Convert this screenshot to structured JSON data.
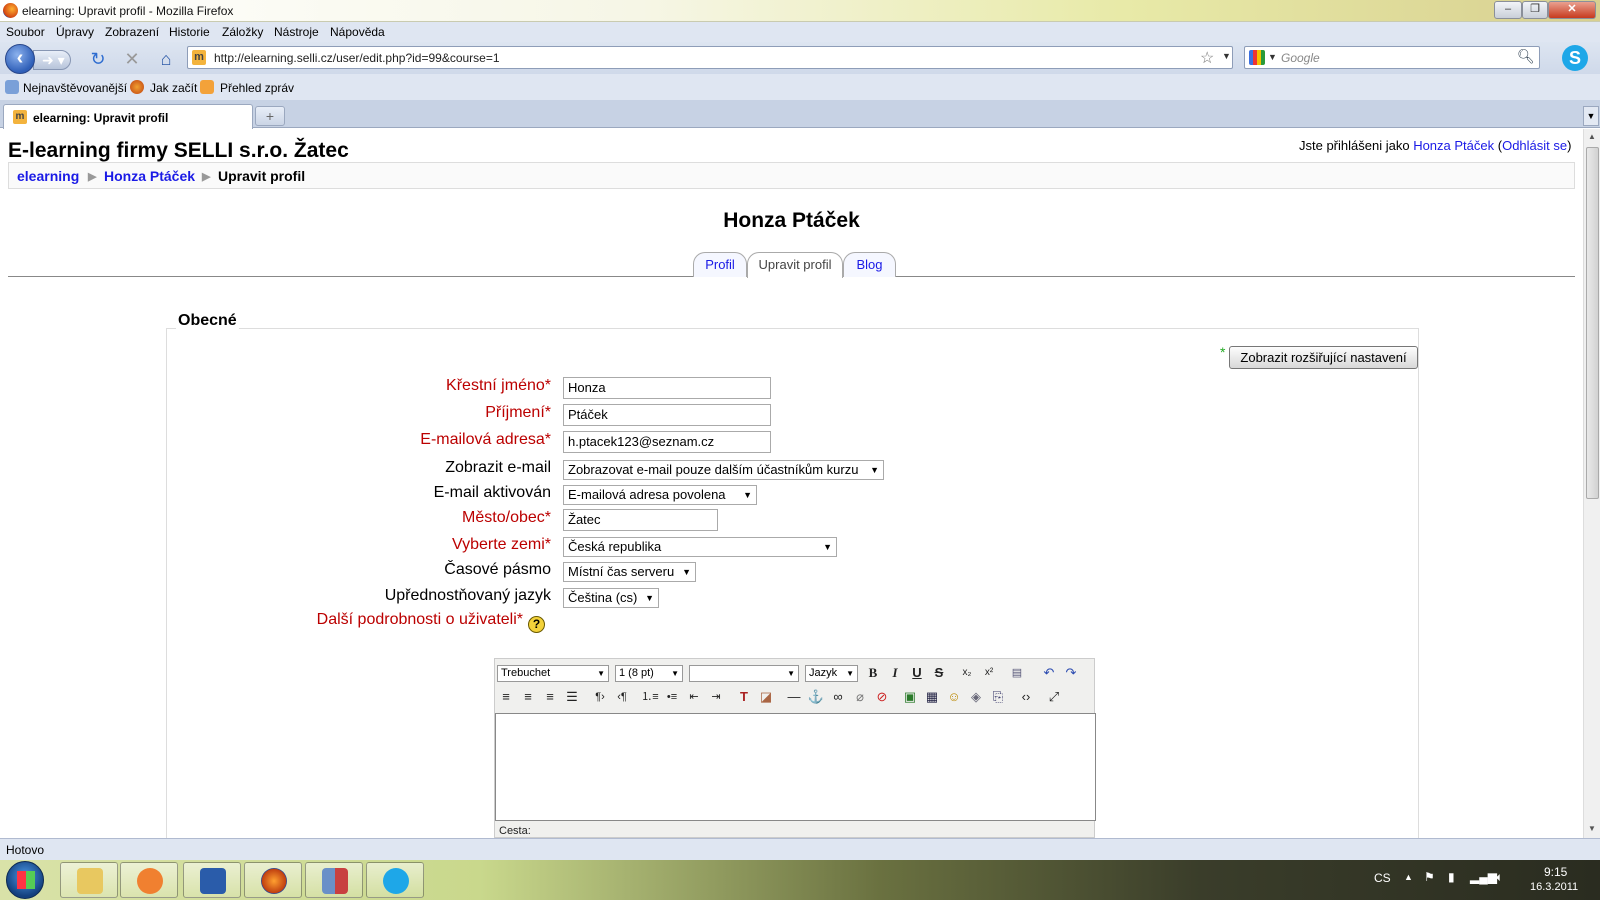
{
  "window": {
    "title": "elearning: Upravit profil - Mozilla Firefox"
  },
  "menu": [
    "Soubor",
    "Úpravy",
    "Zobrazení",
    "Historie",
    "Záložky",
    "Nástroje",
    "Nápověda"
  ],
  "address": {
    "url": "http://elearning.selli.cz/user/edit.php?id=99&course=1"
  },
  "search": {
    "placeholder": "Google"
  },
  "bookmarks": [
    "Nejnavštěvovanější",
    "Jak začít",
    "Přehled zpráv"
  ],
  "tab": {
    "label": "elearning: Upravit profil"
  },
  "site": {
    "header": "E-learning firmy SELLI s.r.o. Žatec",
    "login_prefix": "Jste přihlášeni jako",
    "login_user": "Honza Ptáček",
    "logout": "Odhlásit se",
    "breadcrumb": [
      "elearning",
      "Honza Ptáček",
      "Upravit profil"
    ]
  },
  "page": {
    "title": "Honza Ptáček",
    "tabs": [
      "Profil",
      "Upravit profil",
      "Blog"
    ],
    "active_tab": "Upravit profil"
  },
  "form": {
    "legend": "Obecné",
    "advanced_button": "Zobrazit rozšiřující nastavení",
    "firstname": {
      "label": "Křestní jméno",
      "value": "Honza"
    },
    "lastname": {
      "label": "Příjmení",
      "value": "Ptáček"
    },
    "email": {
      "label": "E-mailová adresa",
      "value": "h.ptacek123@seznam.cz"
    },
    "maildisplay": {
      "label": "Zobrazit e-mail",
      "value": "Zobrazovat e-mail pouze dalším účastníkům kurzu"
    },
    "emailstop": {
      "label": "E-mail aktivován",
      "value": "E-mailová adresa povolena"
    },
    "city": {
      "label": "Město/obec",
      "value": "Žatec"
    },
    "country": {
      "label": "Vyberte zemi",
      "value": "Česká republika"
    },
    "timezone": {
      "label": "Časové pásmo",
      "value": "Místní čas serveru"
    },
    "lang": {
      "label": "Upřednostňovaný jazyk",
      "value": "Čeština (cs)"
    },
    "description": {
      "label": "Další podrobnosti o uživateli"
    },
    "required_mark": "*"
  },
  "editor": {
    "font": "Trebuchet",
    "size": "1 (8 pt)",
    "format": "",
    "lang": "Jazyk",
    "path_label": "Cesta:"
  },
  "status": "Hotovo",
  "tray": {
    "lang": "CS",
    "time": "9:15",
    "date": "16.3.2011"
  }
}
